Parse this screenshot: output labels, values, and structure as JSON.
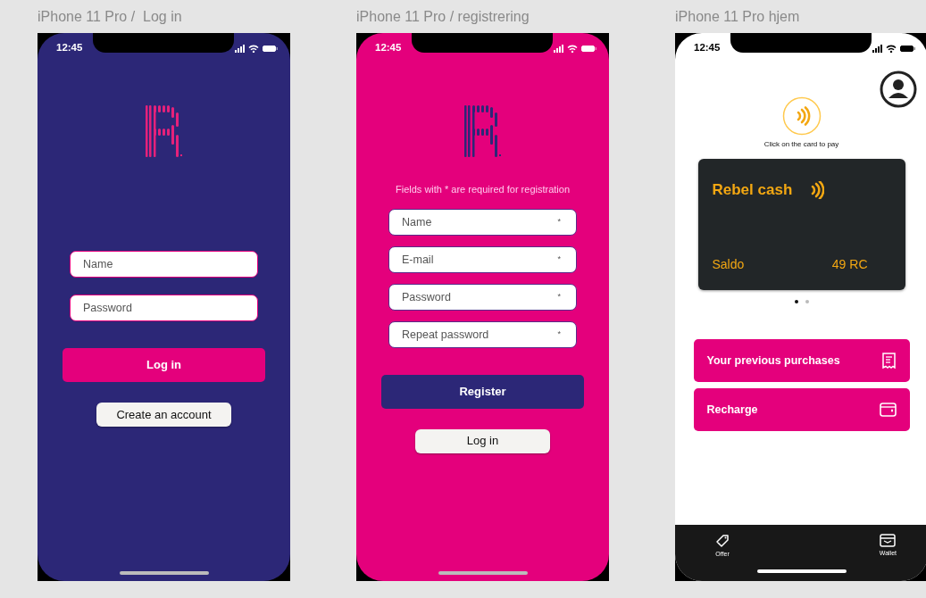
{
  "frames": [
    {
      "kind": "login",
      "title": "iPhone 11 Pro /  Log in",
      "time": "12:45",
      "fields": [
        {
          "placeholder": "Name"
        },
        {
          "placeholder": "Password"
        }
      ],
      "primary_button": "Log in",
      "secondary_button": "Create an account"
    },
    {
      "kind": "register",
      "title": "iPhone 11 Pro / registrering",
      "time": "12:45",
      "note": "Fields with * are required for registration",
      "fields": [
        {
          "placeholder": "Name",
          "marker": "*"
        },
        {
          "placeholder": "E-mail",
          "marker": "*"
        },
        {
          "placeholder": "Password",
          "marker": "*"
        },
        {
          "placeholder": "Repeat password",
          "marker": "*"
        }
      ],
      "primary_button": "Register",
      "secondary_button": "Log in"
    },
    {
      "kind": "home",
      "title": "iPhone 11 Pro hjem",
      "time": "12:45",
      "pay_hint": "Click on the card to pay",
      "card": {
        "title": "Rebel cash",
        "label": "Saldo",
        "value": "49 RC"
      },
      "pager": [
        {
          "selected": true
        },
        {
          "selected": false
        }
      ],
      "actions": [
        {
          "label": "Your previous purchases",
          "kind": "receipt"
        },
        {
          "label": "Recharge",
          "kind": "wallet"
        }
      ],
      "tabs": [
        {
          "label": "Offer",
          "kind": "tag"
        },
        {
          "label": "Wallet",
          "kind": "wallet"
        }
      ]
    }
  ]
}
